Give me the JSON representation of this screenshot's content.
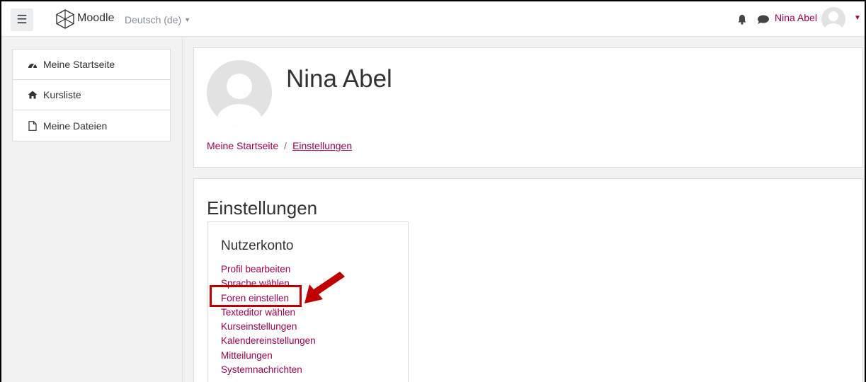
{
  "navbar": {
    "brand": "Moodle",
    "language": "Deutsch (de)",
    "user_name": "Nina Abel"
  },
  "drawer": {
    "items": [
      {
        "label": "Meine Startseite",
        "icon": "dashboard-icon"
      },
      {
        "label": "Kursliste",
        "icon": "home-icon"
      },
      {
        "label": "Meine Dateien",
        "icon": "file-icon"
      }
    ]
  },
  "header": {
    "title": "Nina Abel",
    "breadcrumb": [
      "Meine Startseite",
      "Einstellungen"
    ],
    "breadcrumb_separator": "/"
  },
  "main": {
    "section_title": "Einstellungen",
    "account": {
      "title": "Nutzerkonto",
      "links": [
        "Profil bearbeiten",
        "Sprache wählen",
        "Foren einstellen",
        "Texteditor wählen",
        "Kurseinstellungen",
        "Kalendereinstellungen",
        "Mitteilungen",
        "Systemnachrichten"
      ]
    }
  },
  "annotation": {
    "highlighted_item": "Foren einstellen",
    "color": "#c00000"
  },
  "colors": {
    "link": "#a3004a",
    "background": "#f2f2f2"
  }
}
